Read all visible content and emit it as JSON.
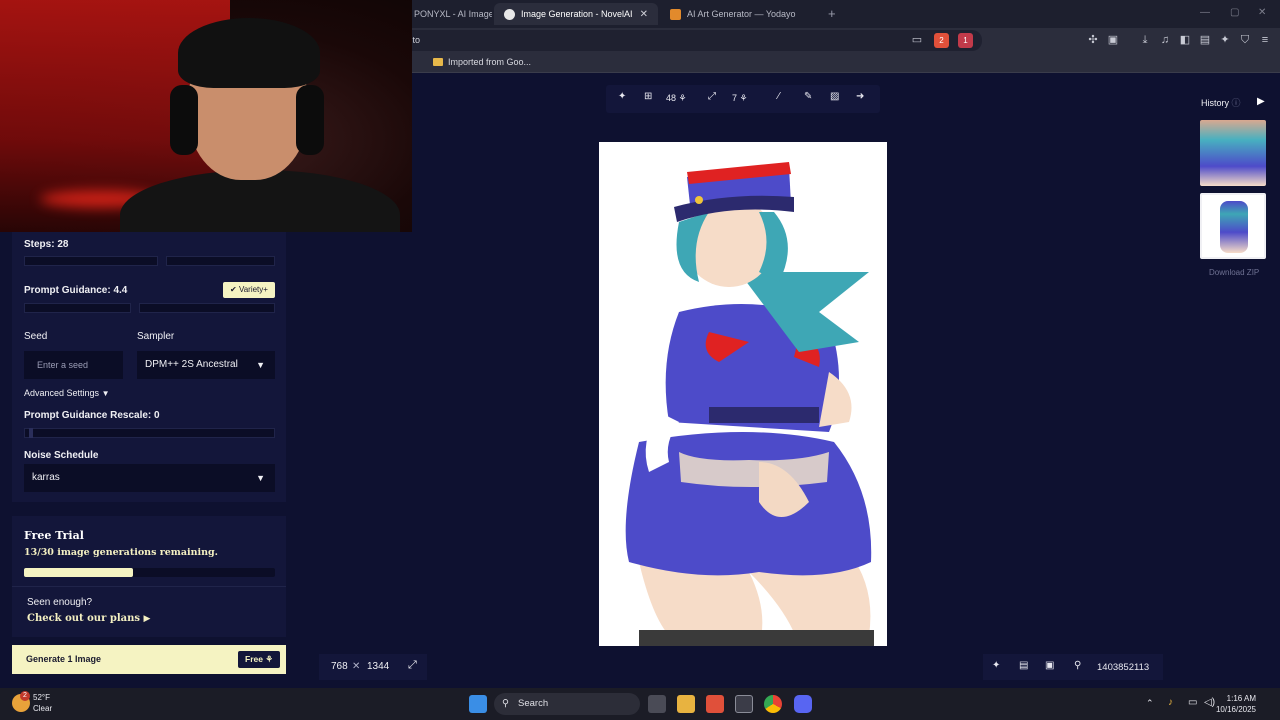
{
  "browser": {
    "tabs": [
      {
        "label": "PONYXL - AI Image"
      },
      {
        "label": "Image Generation - NovelAI"
      },
      {
        "label": "AI Art Generator — Yodayo"
      }
    ],
    "url_fragment": ".to",
    "bookmark": "Imported from Goo...",
    "shield_badge": "2",
    "alert_badge": "1"
  },
  "settings": {
    "steps_label": "Steps:",
    "steps_value": "28",
    "guidance_label": "Prompt Guidance:",
    "guidance_value": "4.4",
    "variety_label": "✔ Variety+",
    "seed_label": "Seed",
    "seed_placeholder": "Enter a seed",
    "sampler_label": "Sampler",
    "sampler_value": "DPM++ 2S Ancestral",
    "advanced_label": "Advanced Settings",
    "rescale_label": "Prompt Guidance Rescale:",
    "rescale_value": "0",
    "noise_label": "Noise Schedule",
    "noise_value": "karras"
  },
  "trial": {
    "title": "Free Trial",
    "remaining": "13/30 image generations remaining.",
    "progress_fraction": 0.433,
    "seen_text": "Seen enough?",
    "plans_text": "Check out our plans"
  },
  "generate": {
    "label": "Generate 1 Image",
    "free_label": "Free"
  },
  "top_toolbar": {
    "steps_cost": "48",
    "upscale_cost": "7"
  },
  "image": {
    "width": "768",
    "height": "1344",
    "times": "✕",
    "seed": "1403852113"
  },
  "history": {
    "title": "History",
    "download_label": "Download ZIP"
  },
  "taskbar": {
    "temperature": "52°F",
    "condition": "Clear",
    "search_label": "Search",
    "time": "1:16 AM",
    "date": "10/16/2025",
    "weather_badge": "2"
  },
  "colors": {
    "background": "#0e1130",
    "panel": "#13163a",
    "accent": "#f5f3c2"
  }
}
